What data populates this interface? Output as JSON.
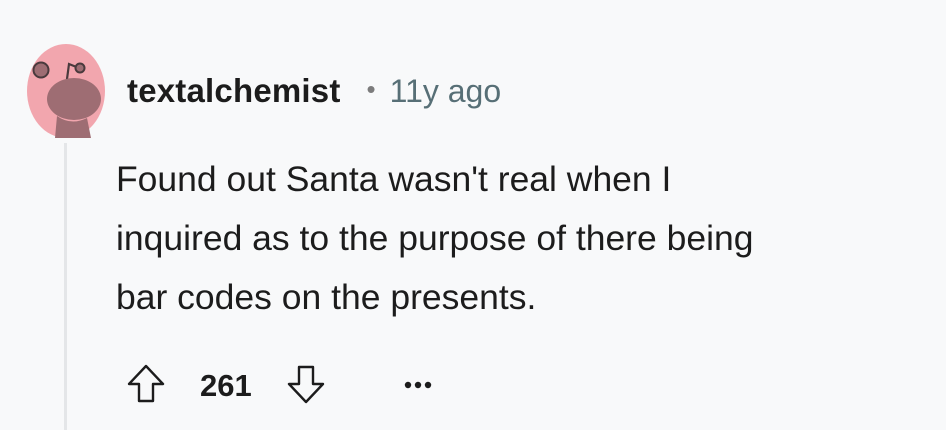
{
  "comment": {
    "author": "textalchemist",
    "separator": "•",
    "age": "11y ago",
    "body_lines": [
      "Found out Santa wasn't real when I",
      "inquired as to the purpose of there being",
      "bar codes on the presents."
    ],
    "score": "261",
    "avatar_icon": "snoo-avatar-icon",
    "upvote_icon": "arrow-up-icon",
    "downvote_icon": "arrow-down-icon",
    "more_icon": "more-horizontal-icon"
  },
  "colors": {
    "background": "#f8f9fa",
    "avatar_background": "#f2a6ae",
    "avatar_figure": "#9e6d73",
    "text": "#1c1c1c",
    "meta": "#576f76",
    "thread_line": "#e4e6e8"
  }
}
